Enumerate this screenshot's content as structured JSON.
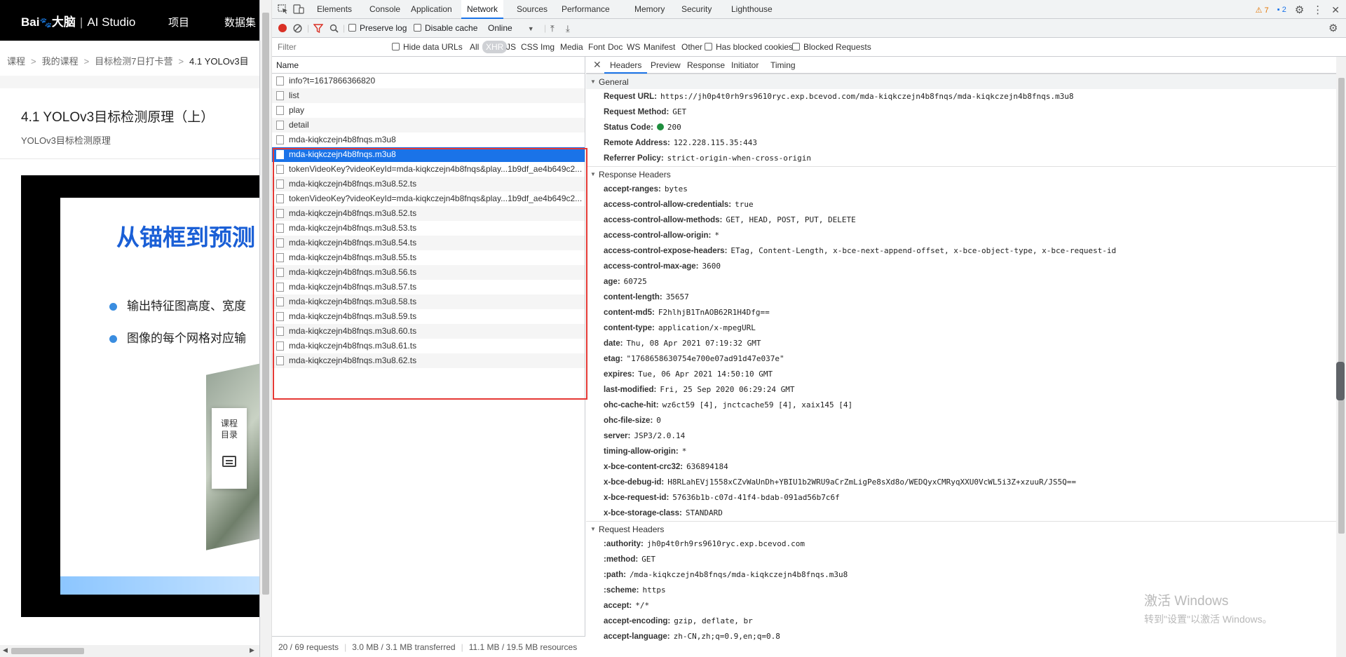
{
  "page": {
    "logo_brand": "Bai",
    "logo_cn": "大脑",
    "logo_studio": "AI Studio",
    "nav": [
      "项目",
      "数据集"
    ],
    "breadcrumb": [
      "课程",
      "我的课程",
      "目标检测7日打卡营",
      "4.1 YOLOv3目"
    ],
    "breadcrumb_sep": ">",
    "title": "4.1 YOLOv3目标检测原理（上）",
    "subtitle": "YOLOv3目标检测原理",
    "slide_title": "从锚框到预测",
    "slide_bullets": [
      "输出特征图高度、宽度",
      "图像的每个网格对应输"
    ],
    "side_panel_label": "课程\n目录"
  },
  "devtools": {
    "tabs": [
      "Elements",
      "Console",
      "Application",
      "Network",
      "Sources",
      "Performance",
      "Memory",
      "Security",
      "Lighthouse"
    ],
    "active_tab": "Network",
    "warn_count": "7",
    "info_count": "2",
    "toolbar": {
      "preserve_log": "Preserve log",
      "disable_cache": "Disable cache",
      "throttle": "Online"
    },
    "filter": {
      "placeholder": "Filter",
      "hide_data_urls": "Hide data URLs",
      "types": [
        "All",
        "XHR",
        "JS",
        "CSS",
        "Img",
        "Media",
        "Font",
        "Doc",
        "WS",
        "Manifest",
        "Other"
      ],
      "active_type": "XHR",
      "has_blocked_cookies": "Has blocked cookies",
      "blocked_requests": "Blocked Requests"
    },
    "requests_header": "Name",
    "requests": [
      "info?t=1617866366820",
      "list",
      "play",
      "detail",
      "mda-kiqkczejn4b8fnqs.m3u8",
      "mda-kiqkczejn4b8fnqs.m3u8",
      "tokenVideoKey?videoKeyId=mda-kiqkczejn4b8fnqs&play...1b9df_ae4b649c2...",
      "mda-kiqkczejn4b8fnqs.m3u8.52.ts",
      "tokenVideoKey?videoKeyId=mda-kiqkczejn4b8fnqs&play...1b9df_ae4b649c2...",
      "mda-kiqkczejn4b8fnqs.m3u8.52.ts",
      "mda-kiqkczejn4b8fnqs.m3u8.53.ts",
      "mda-kiqkczejn4b8fnqs.m3u8.54.ts",
      "mda-kiqkczejn4b8fnqs.m3u8.55.ts",
      "mda-kiqkczejn4b8fnqs.m3u8.56.ts",
      "mda-kiqkczejn4b8fnqs.m3u8.57.ts",
      "mda-kiqkczejn4b8fnqs.m3u8.58.ts",
      "mda-kiqkczejn4b8fnqs.m3u8.59.ts",
      "mda-kiqkczejn4b8fnqs.m3u8.60.ts",
      "mda-kiqkczejn4b8fnqs.m3u8.61.ts",
      "mda-kiqkczejn4b8fnqs.m3u8.62.ts"
    ],
    "selected_request_index": 5,
    "status_bar": {
      "requests": "20 / 69 requests",
      "transferred": "3.0 MB / 3.1 MB transferred",
      "resources": "11.1 MB / 19.5 MB resources"
    },
    "detail_tabs": [
      "Headers",
      "Preview",
      "Response",
      "Initiator",
      "Timing"
    ],
    "active_detail_tab": "Headers",
    "general_title": "General",
    "general": [
      {
        "k": "Request URL:",
        "v": "https://jh0p4t0rh9rs9610ryc.exp.bcevod.com/mda-kiqkczejn4b8fnqs/mda-kiqkczejn4b8fnqs.m3u8"
      },
      {
        "k": "Request Method:",
        "v": "GET"
      },
      {
        "k": "Status Code:",
        "v": "200"
      },
      {
        "k": "Remote Address:",
        "v": "122.228.115.35:443"
      },
      {
        "k": "Referrer Policy:",
        "v": "strict-origin-when-cross-origin"
      }
    ],
    "response_title": "Response Headers",
    "response_headers": [
      {
        "k": "accept-ranges:",
        "v": "bytes"
      },
      {
        "k": "access-control-allow-credentials:",
        "v": "true"
      },
      {
        "k": "access-control-allow-methods:",
        "v": "GET, HEAD, POST, PUT, DELETE"
      },
      {
        "k": "access-control-allow-origin:",
        "v": "*"
      },
      {
        "k": "access-control-expose-headers:",
        "v": "ETag, Content-Length, x-bce-next-append-offset, x-bce-object-type, x-bce-request-id"
      },
      {
        "k": "access-control-max-age:",
        "v": "3600"
      },
      {
        "k": "age:",
        "v": "60725"
      },
      {
        "k": "content-length:",
        "v": "35657"
      },
      {
        "k": "content-md5:",
        "v": "F2hlhjB1TnAOB62R1H4Dfg=="
      },
      {
        "k": "content-type:",
        "v": "application/x-mpegURL"
      },
      {
        "k": "date:",
        "v": "Thu, 08 Apr 2021 07:19:32 GMT"
      },
      {
        "k": "etag:",
        "v": "\"1768658630754e700e07ad91d47e037e\""
      },
      {
        "k": "expires:",
        "v": "Tue, 06 Apr 2021 14:50:10 GMT"
      },
      {
        "k": "last-modified:",
        "v": "Fri, 25 Sep 2020 06:29:24 GMT"
      },
      {
        "k": "ohc-cache-hit:",
        "v": "wz6ct59 [4], jnctcache59 [4], xaix145 [4]"
      },
      {
        "k": "ohc-file-size:",
        "v": "0"
      },
      {
        "k": "server:",
        "v": "JSP3/2.0.14"
      },
      {
        "k": "timing-allow-origin:",
        "v": "*"
      },
      {
        "k": "x-bce-content-crc32:",
        "v": "636894184"
      },
      {
        "k": "x-bce-debug-id:",
        "v": "H8RLahEVj1558xCZvWaUnDh+YBIU1b2WRU9aCrZmLigPe8sXd8o/WEDQyxCMRyqXXU0VcWL5i3Z+xzuuR/JS5Q=="
      },
      {
        "k": "x-bce-request-id:",
        "v": "57636b1b-c07d-41f4-bdab-091ad56b7c6f"
      },
      {
        "k": "x-bce-storage-class:",
        "v": "STANDARD"
      }
    ],
    "request_title": "Request Headers",
    "request_headers": [
      {
        "k": ":authority:",
        "v": "jh0p4t0rh9rs9610ryc.exp.bcevod.com"
      },
      {
        "k": ":method:",
        "v": "GET"
      },
      {
        "k": ":path:",
        "v": "/mda-kiqkczejn4b8fnqs/mda-kiqkczejn4b8fnqs.m3u8"
      },
      {
        "k": ":scheme:",
        "v": "https"
      },
      {
        "k": "accept:",
        "v": "*/*"
      },
      {
        "k": "accept-encoding:",
        "v": "gzip, deflate, br"
      },
      {
        "k": "accept-language:",
        "v": "zh-CN,zh;q=0.9,en;q=0.8"
      }
    ]
  },
  "watermark": {
    "line1": "激活 Windows",
    "line2": "转到\"设置\"以激活 Windows。"
  }
}
